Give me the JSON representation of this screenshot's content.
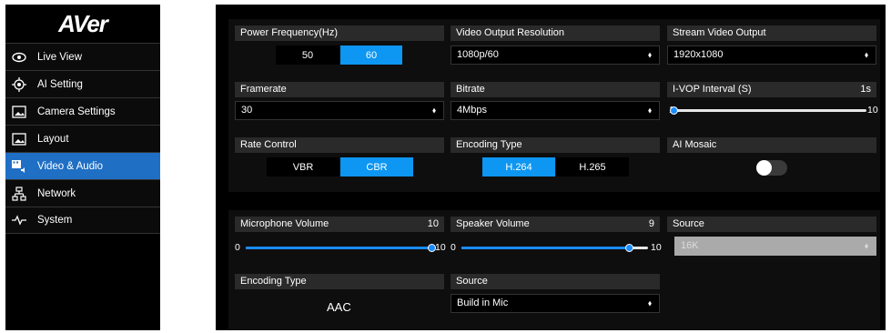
{
  "brand": "AVer",
  "nav": [
    {
      "label": "Live View",
      "icon": "eye-icon"
    },
    {
      "label": "AI Setting",
      "icon": "ai-target-icon"
    },
    {
      "label": "Camera Settings",
      "icon": "image-icon"
    },
    {
      "label": "Layout",
      "icon": "layout-icon"
    },
    {
      "label": "Video & Audio",
      "icon": "video-audio-icon"
    },
    {
      "label": "Network",
      "icon": "network-icon"
    },
    {
      "label": "System",
      "icon": "pulse-icon"
    }
  ],
  "active_nav": "Video & Audio",
  "accent": "#0d96f2",
  "video": {
    "power_frequency": {
      "label": "Power Frequency(Hz)",
      "options": [
        "50",
        "60"
      ],
      "selected": "60"
    },
    "output_resolution": {
      "label": "Video Output Resolution",
      "value": "1080p/60"
    },
    "stream_output": {
      "label": "Stream Video Output",
      "value": "1920x1080"
    },
    "framerate": {
      "label": "Framerate",
      "value": "30"
    },
    "bitrate": {
      "label": "Bitrate",
      "value": "4Mbps"
    },
    "ivop": {
      "label": "I-VOP Interval (S)",
      "value": "1s",
      "min": "1",
      "max": "10",
      "level": 0.0
    },
    "rate_control": {
      "label": "Rate Control",
      "options": [
        "VBR",
        "CBR"
      ],
      "selected": "CBR"
    },
    "encoding_type": {
      "label": "Encoding Type",
      "options": [
        "H.264",
        "H.265"
      ],
      "selected": "H.264"
    },
    "ai_mosaic": {
      "label": "AI Mosaic",
      "on": false
    }
  },
  "audio": {
    "mic_volume": {
      "label": "Microphone Volume",
      "value": "10",
      "min": "0",
      "max": "10",
      "level": 1.0
    },
    "speaker_volume": {
      "label": "Speaker Volume",
      "value": "9",
      "min": "0",
      "max": "10",
      "level": 0.9
    },
    "source_rate": {
      "label": "Source",
      "value": "16K"
    },
    "encoding_type": {
      "label": "Encoding Type",
      "value": "AAC"
    },
    "source": {
      "label": "Source",
      "value": "Build in Mic"
    }
  }
}
